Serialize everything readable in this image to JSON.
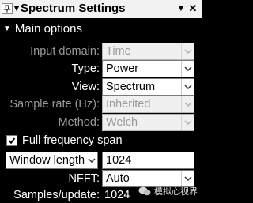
{
  "titlebar": {
    "title": "Spectrum Settings",
    "icons": [
      "collapse-arrow-icon",
      "pin-icon",
      "close-icon"
    ]
  },
  "section": {
    "label": "Main options"
  },
  "fields": {
    "input_domain": {
      "label": "Input domain:",
      "value": "Time",
      "enabled": false
    },
    "type": {
      "label": "Type:",
      "value": "Power",
      "enabled": true
    },
    "view": {
      "label": "View:",
      "value": "Spectrum",
      "enabled": true
    },
    "sample_rate": {
      "label": "Sample rate (Hz):",
      "value": "Inherited",
      "enabled": false
    },
    "method": {
      "label": "Method:",
      "value": "Welch",
      "enabled": false
    },
    "full_frequency_span": {
      "label": "Full frequency span",
      "checked": true
    },
    "window_length": {
      "selector_value": "Window length:",
      "value": "1024"
    },
    "nfft": {
      "label": "NFFT:",
      "value": "Auto"
    },
    "samples_update": {
      "label": "Samples/update:",
      "value": "1024"
    }
  },
  "watermark": {
    "text": "模拟心视界"
  },
  "colors": {
    "background": "#000000",
    "titlebar": "#f2f2f2",
    "disabled_text": "#9a9a9a"
  }
}
